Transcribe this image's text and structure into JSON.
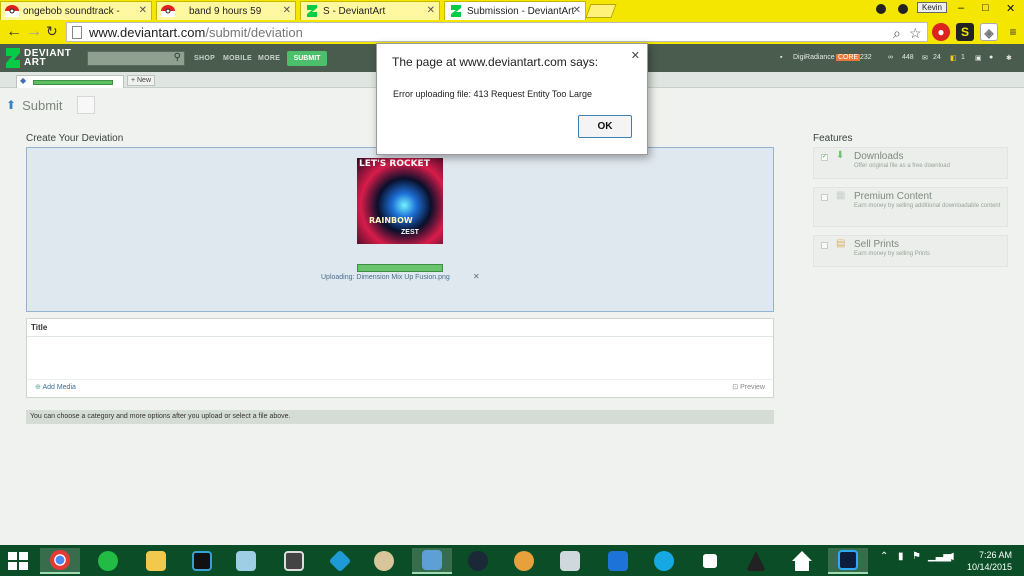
{
  "browser": {
    "tabs": [
      {
        "label": "ongebob soundtrack - "
      },
      {
        "label": "band 9 hours 59"
      },
      {
        "label": "S    - DeviantArt"
      },
      {
        "label": "Submission - DeviantArt"
      }
    ],
    "profile_name": "Kevin",
    "url_host": "www.deviantart.com",
    "url_path": "/submit/deviation"
  },
  "da_header": {
    "logo_line1": "DEVIANT",
    "logo_line2": "ART",
    "nav": [
      "SHOP",
      "MOBILE",
      "MORE"
    ],
    "submit_label": "SUBMIT",
    "username": "DigiRadiance",
    "user_badge": "CORE",
    "stats": [
      "232",
      "448",
      "24",
      "1"
    ]
  },
  "subtabs": {
    "new_label": "+ New"
  },
  "page": {
    "heading": "Submit",
    "create_label": "Create Your Deviation",
    "thumbnail_text": {
      "line1": "LET'S ROCKET",
      "line2": "RAINBOW",
      "line3": "ZEST"
    },
    "upload_status": "Uploading: Dimension Mix Up Fusion.png",
    "upload_progress": 1.0,
    "title_label": "Title",
    "add_media": "Add Media",
    "preview": "Preview",
    "hint": "You can choose a category and more options after you upload or select a file above."
  },
  "features": {
    "heading": "Features",
    "items": [
      {
        "name": "Downloads",
        "desc": "Offer original file as a free download",
        "checked": true
      },
      {
        "name": "Premium Content",
        "desc": "Earn money by selling additional downloadable content",
        "checked": false
      },
      {
        "name": "Sell Prints",
        "desc": "Earn money by selling Prints",
        "checked": false
      }
    ]
  },
  "dialog": {
    "title": "The page at www.deviantart.com says:",
    "message": "Error uploading file: 413 Request Entity Too Large",
    "ok_label": "OK"
  },
  "taskbar": {
    "time": "7:26 AM",
    "date": "10/14/2015"
  },
  "colors": {
    "chrome_theme": "#f5e600",
    "da_header": "#4a5c4e",
    "da_green": "#05cc47",
    "taskbar": "#0b4d26",
    "upload_box": "#e0e8ef"
  }
}
